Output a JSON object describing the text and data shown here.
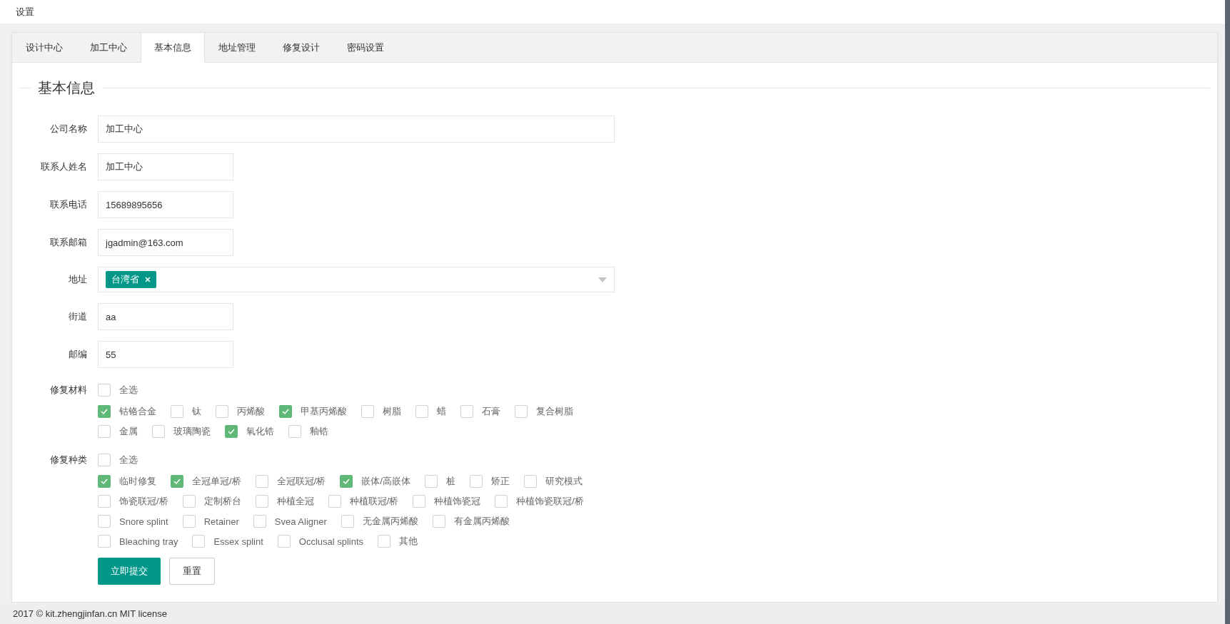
{
  "header": {
    "title": "设置"
  },
  "tabs": [
    {
      "label": "设计中心",
      "selected": false
    },
    {
      "label": "加工中心",
      "selected": false
    },
    {
      "label": "基本信息",
      "selected": true
    },
    {
      "label": "地址管理",
      "selected": false
    },
    {
      "label": "修复设计",
      "selected": false
    },
    {
      "label": "密码设置",
      "selected": false
    }
  ],
  "section": {
    "legend": "基本信息"
  },
  "fields": [
    {
      "kind": "long_text",
      "label": "公司名称",
      "value": "加工中心"
    },
    {
      "kind": "short_text",
      "label": "联系人姓名",
      "value": "加工中心"
    },
    {
      "kind": "short_text",
      "label": "联系电话",
      "value": "15689895656"
    },
    {
      "kind": "short_text",
      "label": "联系邮箱",
      "value": "jgadmin@163.com"
    },
    {
      "kind": "select",
      "label": "地址",
      "tags": [
        "台湾省"
      ]
    },
    {
      "kind": "short_text",
      "label": "街道",
      "value": "aa"
    },
    {
      "kind": "short_text",
      "label": "邮编",
      "value": "55"
    }
  ],
  "checkbox_groups": [
    {
      "label": "修复材料",
      "select_all": {
        "label": "全选",
        "checked": false
      },
      "options": [
        {
          "label": "钴铬合金",
          "checked": true
        },
        {
          "label": "钛",
          "checked": false
        },
        {
          "label": "丙烯酸",
          "checked": false
        },
        {
          "label": "甲基丙烯酸",
          "checked": true
        },
        {
          "label": "树脂",
          "checked": false
        },
        {
          "label": "蜡",
          "checked": false
        },
        {
          "label": "石膏",
          "checked": false
        },
        {
          "label": "复合树脂",
          "checked": false
        },
        {
          "label": "金属",
          "checked": false
        },
        {
          "label": "玻璃陶瓷",
          "checked": false
        },
        {
          "label": "氧化锆",
          "checked": true
        },
        {
          "label": "釉锆",
          "checked": false
        }
      ]
    },
    {
      "label": "修复种类",
      "select_all": {
        "label": "全选",
        "checked": false
      },
      "options": [
        {
          "label": "临时修复",
          "checked": true
        },
        {
          "label": "全冠单冠/桥",
          "checked": true
        },
        {
          "label": "全冠联冠/桥",
          "checked": false
        },
        {
          "label": "嵌体/高嵌体",
          "checked": true
        },
        {
          "label": "桩",
          "checked": false
        },
        {
          "label": "矫正",
          "checked": false
        },
        {
          "label": "研究模式",
          "checked": false
        },
        {
          "label": "饰瓷联冠/桥",
          "checked": false
        },
        {
          "label": "定制桥台",
          "checked": false
        },
        {
          "label": "种植全冠",
          "checked": false
        },
        {
          "label": "种植联冠/桥",
          "checked": false
        },
        {
          "label": "种植饰瓷冠",
          "checked": false
        },
        {
          "label": "种植饰瓷联冠/桥",
          "checked": false
        },
        {
          "label": "Snore splint",
          "checked": false
        },
        {
          "label": "Retainer",
          "checked": false
        },
        {
          "label": "Svea Aligner",
          "checked": false
        },
        {
          "label": "无金属丙烯酸",
          "checked": false
        },
        {
          "label": "有金属丙烯酸",
          "checked": false
        },
        {
          "label": "Bleaching tray",
          "checked": false
        },
        {
          "label": "Essex splint",
          "checked": false
        },
        {
          "label": "Occlusal splints",
          "checked": false
        },
        {
          "label": "其他",
          "checked": false
        }
      ]
    }
  ],
  "buttons": [
    {
      "label": "立即提交",
      "kind": "primary"
    },
    {
      "label": "重置",
      "kind": "default"
    }
  ],
  "footer": "2017 © kit.zhengjinfan.cn MIT license"
}
